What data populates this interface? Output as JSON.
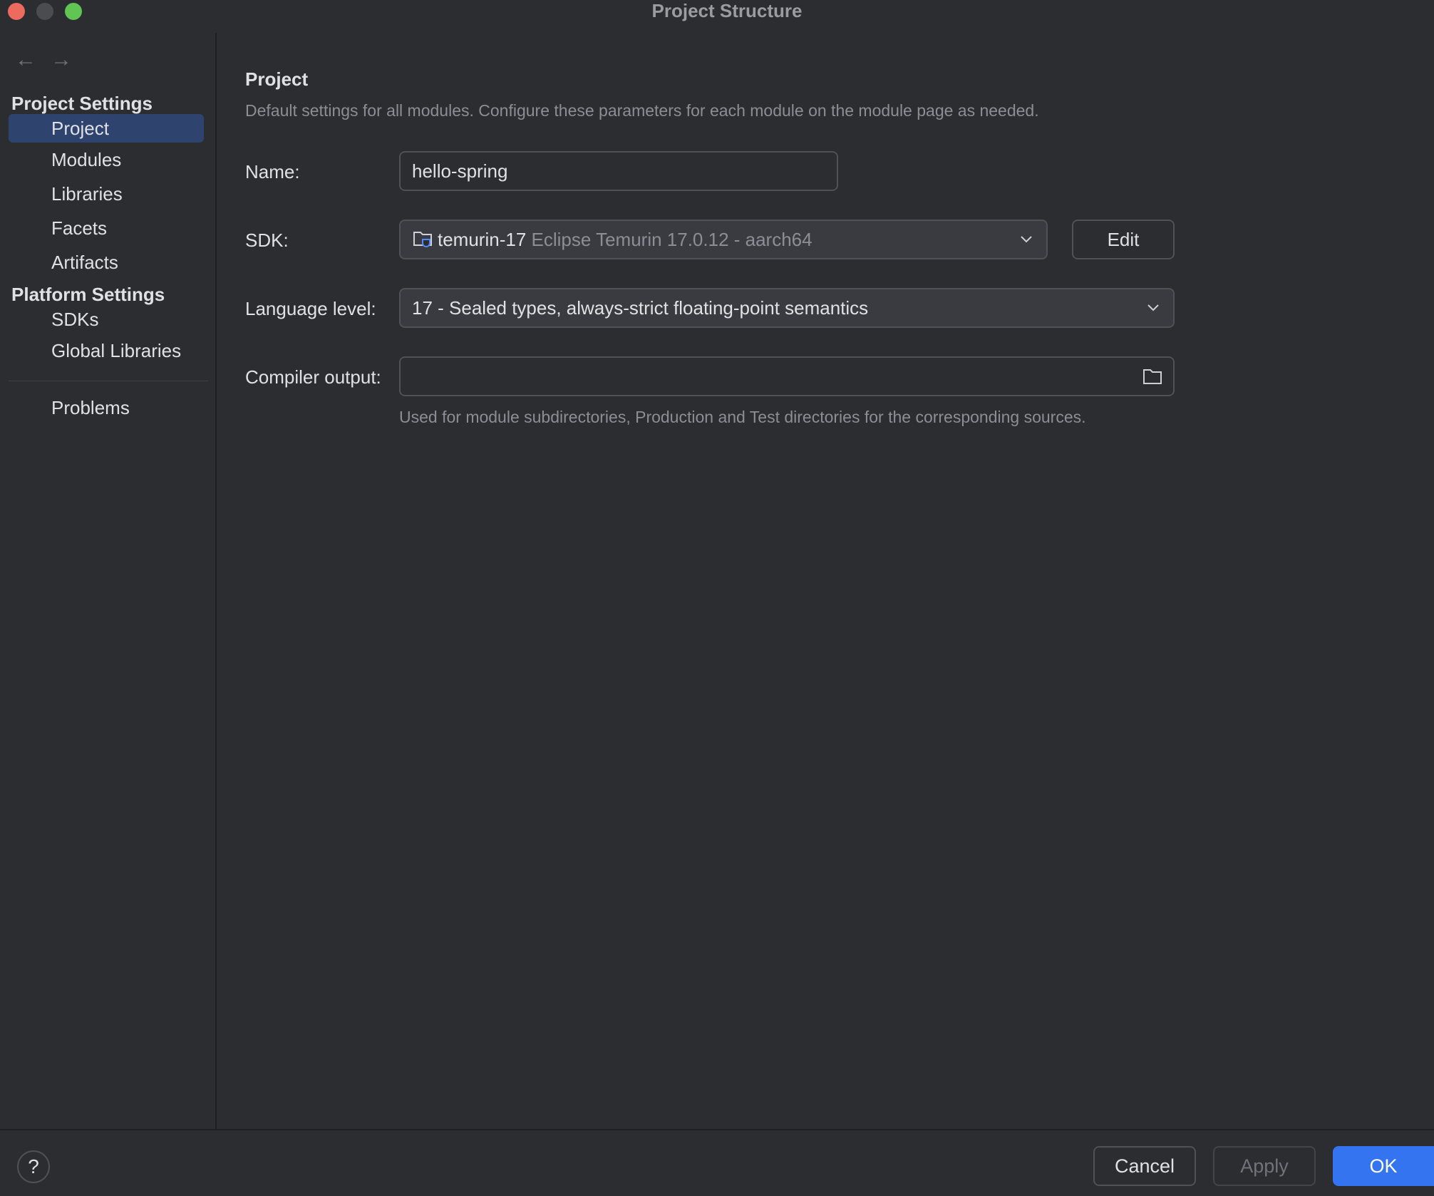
{
  "window": {
    "title": "Project Structure"
  },
  "sidebar": {
    "project_settings_title": "Project Settings",
    "project_settings_items": [
      {
        "label": "Project",
        "selected": true
      },
      {
        "label": "Modules"
      },
      {
        "label": "Libraries"
      },
      {
        "label": "Facets"
      },
      {
        "label": "Artifacts"
      }
    ],
    "platform_settings_title": "Platform Settings",
    "platform_settings_items": [
      {
        "label": "SDKs"
      },
      {
        "label": "Global Libraries"
      }
    ],
    "problems_label": "Problems"
  },
  "main": {
    "title": "Project",
    "description": "Default settings for all modules. Configure these parameters for each module on the module page as needed.",
    "name": {
      "label": "Name:",
      "value": "hello-spring"
    },
    "sdk": {
      "label": "SDK:",
      "name": "temurin-17",
      "detail": "Eclipse Temurin 17.0.12 - aarch64",
      "edit_label": "Edit"
    },
    "language_level": {
      "label": "Language level:",
      "value": "17 - Sealed types, always-strict floating-point semantics"
    },
    "compiler_output": {
      "label": "Compiler output:",
      "value": "",
      "hint": "Used for module subdirectories, Production and Test directories for the corresponding sources."
    }
  },
  "footer": {
    "help_label": "?",
    "cancel_label": "Cancel",
    "apply_label": "Apply",
    "ok_label": "OK"
  },
  "colors": {
    "background": "#2b2d30",
    "selection": "#2e436e",
    "accent": "#3574f0"
  }
}
